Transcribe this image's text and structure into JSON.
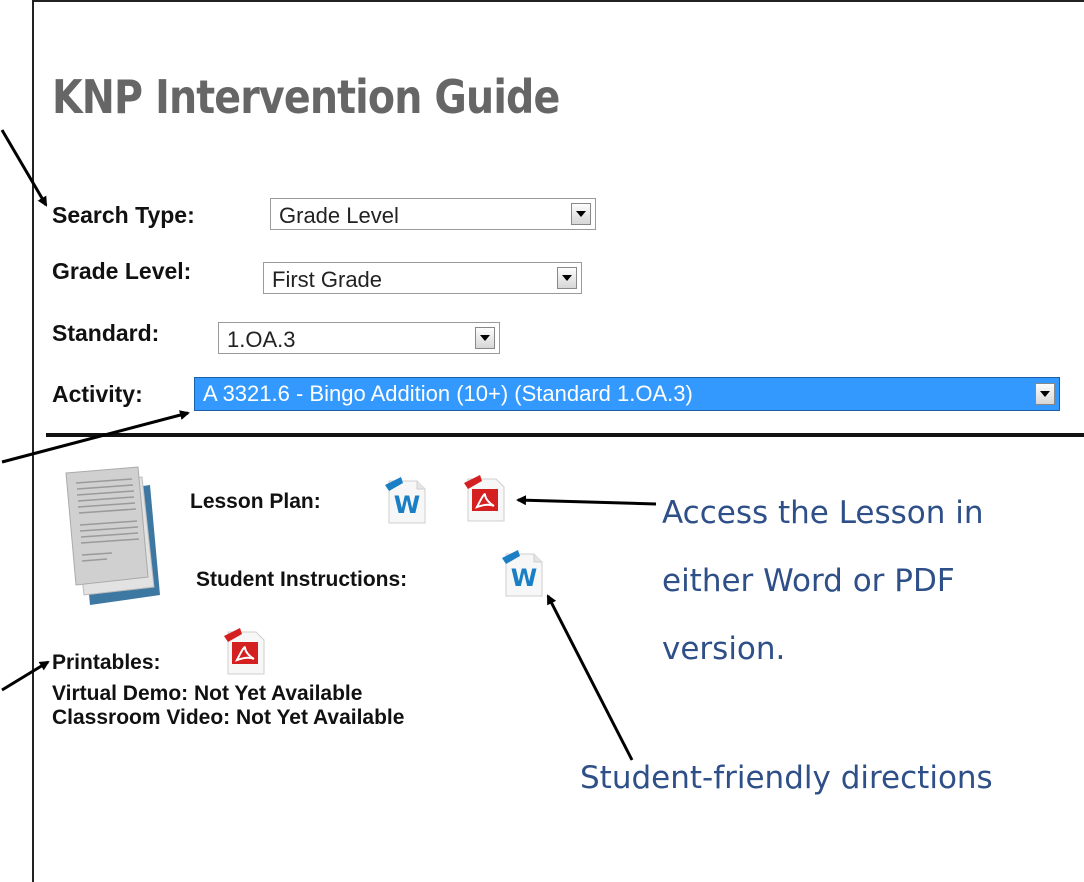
{
  "title": "KNP Intervention Guide",
  "form": {
    "search_type": {
      "label": "Search Type:",
      "value": "Grade Level"
    },
    "grade_level": {
      "label": "Grade Level:",
      "value": "First Grade"
    },
    "standard": {
      "label": "Standard:",
      "value": "1.OA.3"
    },
    "activity": {
      "label": "Activity:",
      "value": "A 3321.6 - Bingo Addition (10+) (Standard 1.OA.3)"
    }
  },
  "resources": {
    "lesson_plan_label": "Lesson Plan:",
    "student_instructions_label": "Student Instructions:",
    "printables_label": "Printables:",
    "virtual_demo": "Virtual Demo: Not Yet Available",
    "classroom_video": "Classroom Video: Not Yet Available"
  },
  "annotations": {
    "access_line1": "Access the Lesson in",
    "access_line2": "either Word or PDF",
    "access_line3": "version.",
    "student_friendly": "Student-friendly directions"
  },
  "icons": {
    "word": "word-doc-icon",
    "pdf": "pdf-doc-icon",
    "document": "document-stack-icon"
  },
  "colors": {
    "title": "#666666",
    "annotation": "#2e4f87",
    "selected": "#3399ff",
    "word_blue": "#1a7fc4",
    "pdf_red": "#d42020"
  }
}
